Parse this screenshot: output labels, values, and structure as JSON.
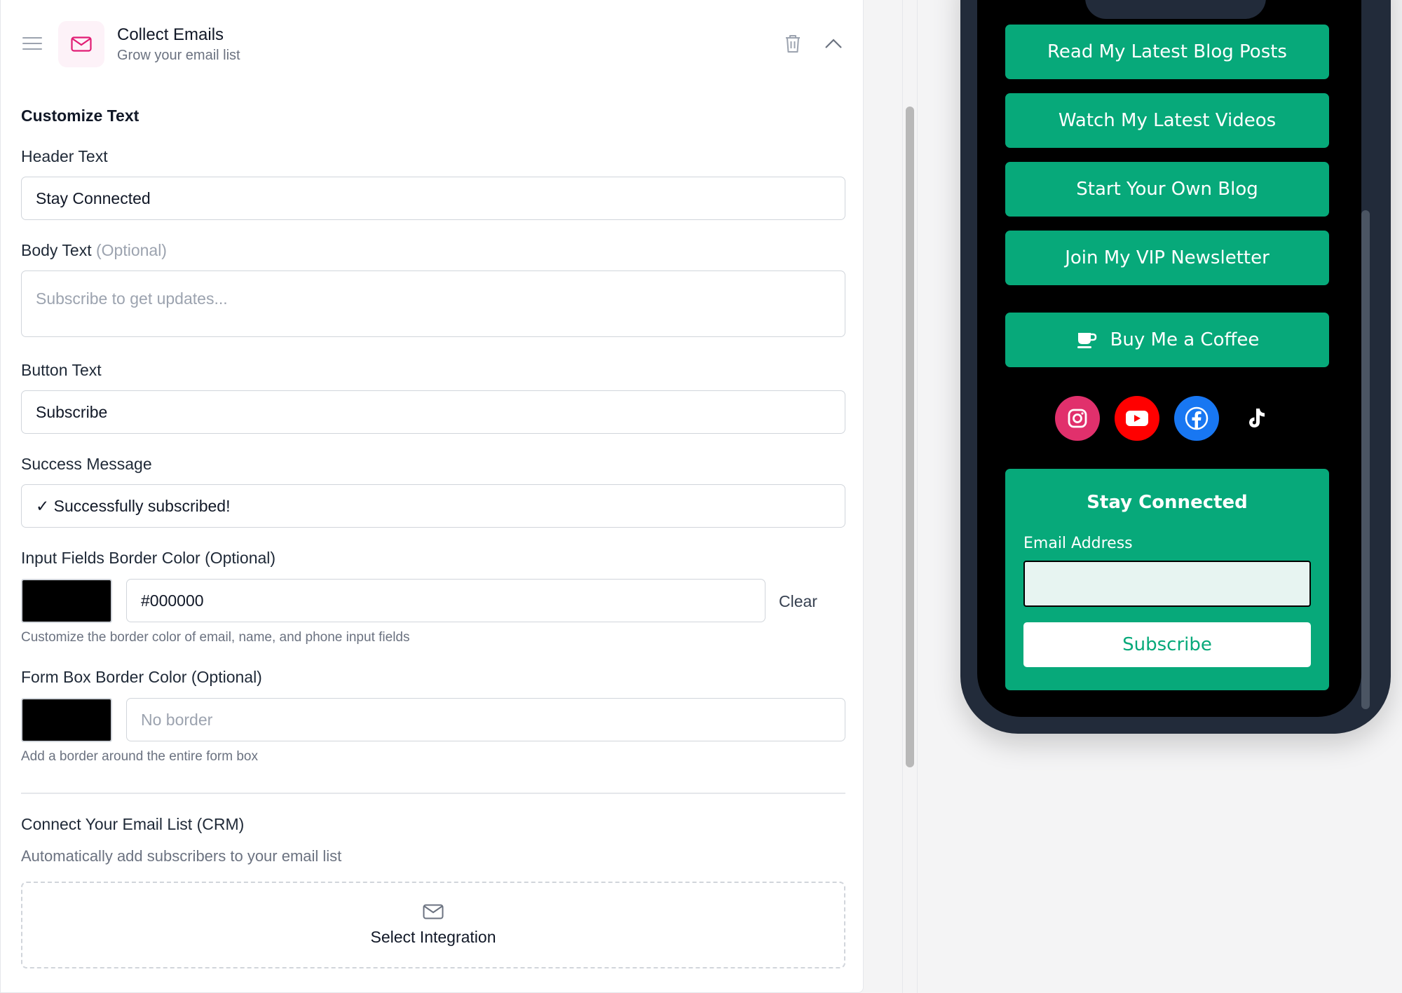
{
  "card": {
    "title": "Collect Emails",
    "subtitle": "Grow your email list",
    "icon": "mail-icon"
  },
  "customize": {
    "section_title": "Customize Text",
    "header_label": "Header Text",
    "header_value": "Stay Connected",
    "body_label": "Body Text",
    "body_optional": "(Optional)",
    "body_placeholder": "Subscribe to get updates...",
    "button_label": "Button Text",
    "button_value": "Subscribe",
    "success_label": "Success Message",
    "success_value": "✓ Successfully subscribed!"
  },
  "input_border": {
    "label": "Input Fields Border Color (Optional)",
    "swatch_color": "#000000",
    "value": "#000000",
    "clear_label": "Clear",
    "help": "Customize the border color of email, name, and phone input fields"
  },
  "form_border": {
    "label": "Form Box Border Color (Optional)",
    "swatch_color": "#000000",
    "placeholder": "No border",
    "help": "Add a border around the entire form box"
  },
  "crm": {
    "title": "Connect Your Email List (CRM)",
    "subtitle": "Automatically add subscribers to your email list",
    "select_label": "Select Integration"
  },
  "preview": {
    "accent": "#07a97a",
    "links": [
      "Read My Latest Blog Posts",
      "Watch My Latest Videos",
      "Start Your Own Blog",
      "Join My VIP Newsletter"
    ],
    "coffee_label": "Buy Me a Coffee",
    "socials": [
      "instagram-icon",
      "youtube-icon",
      "facebook-icon",
      "tiktok-icon"
    ],
    "form_title": "Stay Connected",
    "email_label": "Email Address",
    "subscribe_label": "Subscribe"
  }
}
